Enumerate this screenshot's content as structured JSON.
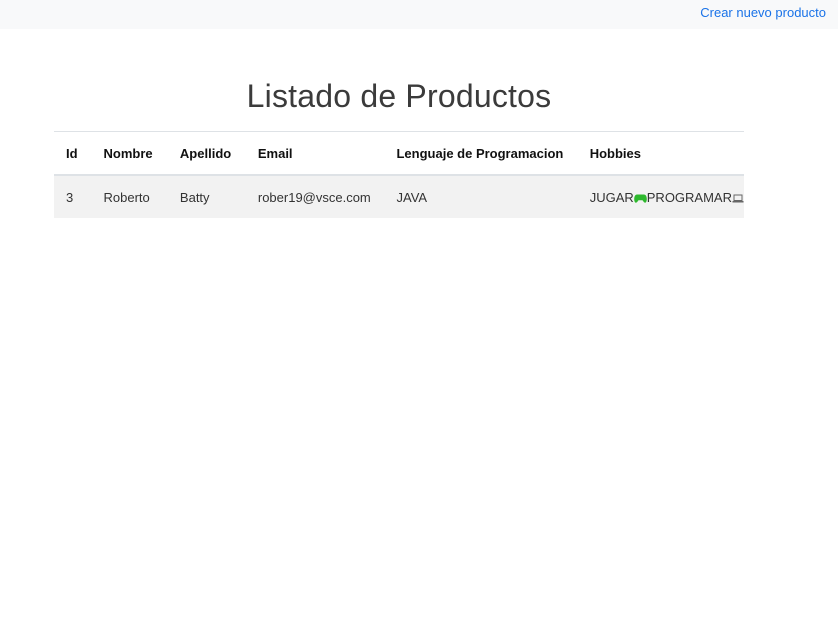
{
  "navbar": {
    "create_link": "Crear nuevo producto"
  },
  "page": {
    "title": "Listado de Productos"
  },
  "table": {
    "headers": [
      "Id",
      "Nombre",
      "Apellido",
      "Email",
      "Lenguaje de Programacion",
      "Hobbies"
    ],
    "rows": [
      {
        "id": "3",
        "nombre": "Roberto",
        "apellido": "Batty",
        "email": "rober19@vsce.com",
        "lenguaje": "JAVA",
        "hobbies": [
          {
            "label": "JUGAR",
            "icon": "gamepad-icon"
          },
          {
            "label": "PROGRAMAR",
            "icon": "laptop-icon"
          }
        ]
      }
    ]
  },
  "colors": {
    "link": "#1a73e8",
    "navbar_bg": "#f8f9fa",
    "row_bg": "#f2f2f2",
    "gamepad_icon": "#2eb82e"
  }
}
